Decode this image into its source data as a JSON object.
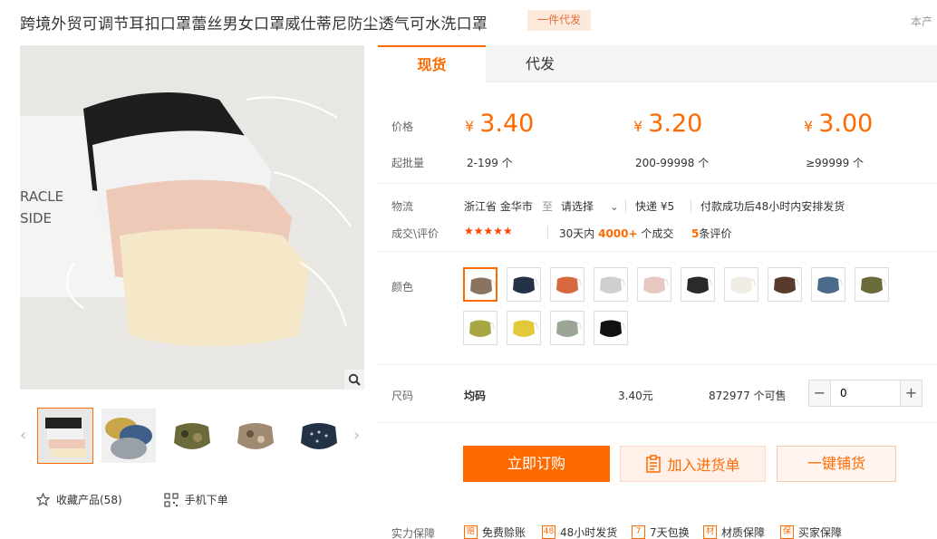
{
  "product": {
    "title": "跨境外贸可调节耳扣口罩蕾丝男女口罩威仕蒂尼防尘透气可水洗口罩",
    "tag": "一件代发",
    "corner_text": "本产"
  },
  "gallery": {
    "main_image": "lace-masks-photo",
    "zoom_icon": "search-icon",
    "prev_icon": "chevron-left-icon",
    "next_icon": "chevron-right-icon",
    "thumbnails": [
      "lace-masks-thumb",
      "sequin-masks-thumb",
      "camo-mask-thumb",
      "paisley-mask-thumb",
      "navy-dot-mask-thumb"
    ]
  },
  "actions": {
    "favorite_label": "收藏产品(58)",
    "mobile_order_label": "手机下单"
  },
  "tabs": [
    "现货",
    "代发"
  ],
  "pricing": {
    "price_label": "价格",
    "min_label": "起批量",
    "currency": "¥",
    "tiers": [
      {
        "price": "3.40",
        "range": "2-199 个"
      },
      {
        "price": "3.20",
        "range": "200-99998 个"
      },
      {
        "price": "3.00",
        "range": "≥99999 个"
      }
    ]
  },
  "logistics": {
    "label": "物流",
    "origin": "浙江省 金华市",
    "to": "至",
    "destination": "请选择",
    "express": "快递 ¥5",
    "shipping_note": "付款成功后48小时内安排发货"
  },
  "deals": {
    "label": "成交\\评价",
    "stars": "★★★★★",
    "prefix": "30天内",
    "count": "4000+",
    "suffix": "个成交",
    "reviews_count": "5",
    "reviews_suffix": "条评价"
  },
  "color": {
    "label": "颜色",
    "selected_index": 0,
    "options": [
      "#8a7460",
      "#243247",
      "#d6693e",
      "#cfcfcf",
      "#e7c8c1",
      "#2a2a2a",
      "#efece4",
      "#5a3a2c",
      "#4a6a8a",
      "#6b6a3a",
      "#a8a642",
      "#e3c93a",
      "#9aa596",
      "#111111"
    ]
  },
  "size": {
    "label": "尺码",
    "name": "均码",
    "price": "3.40元",
    "stock": "872977 个可售",
    "minus": "−",
    "plus": "+",
    "quantity": "0"
  },
  "buttons": {
    "buy": "立即订购",
    "cart": "加入进货单",
    "distribute": "一键铺货"
  },
  "guarantee": {
    "label": "实力保障",
    "items": [
      {
        "icon": "赔",
        "text": "免费赊账"
      },
      {
        "icon": "48",
        "text": "48小时发货"
      },
      {
        "icon": "7",
        "text": "7天包换"
      },
      {
        "icon": "材",
        "text": "材质保障"
      },
      {
        "icon": "保",
        "text": "买家保障"
      }
    ]
  }
}
